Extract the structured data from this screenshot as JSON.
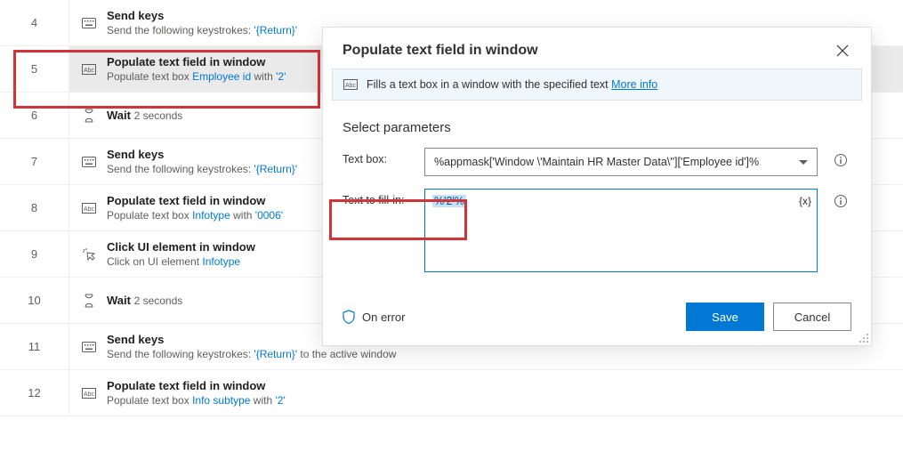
{
  "colors": {
    "accent": "#0078d4",
    "danger": "#d13438"
  },
  "steps": [
    {
      "num": "4",
      "icon": "keyboard",
      "title": "Send keys",
      "sub_prefix": "Send the following keystrokes: ",
      "sub_link": "",
      "sub_mid": "",
      "sub_lit": "'{Return}'",
      "sub_suffix": ""
    },
    {
      "num": "5",
      "icon": "abc-box",
      "title": "Populate text field in window",
      "sub_prefix": "Populate text box ",
      "sub_link": "Employee id",
      "sub_mid": " with ",
      "sub_lit": "'2'",
      "sub_suffix": "",
      "selected": true
    },
    {
      "num": "6",
      "icon": "hourglass",
      "title": "Wait",
      "sub_inline": "2 seconds"
    },
    {
      "num": "7",
      "icon": "keyboard",
      "title": "Send keys",
      "sub_prefix": "Send the following keystrokes: ",
      "sub_link": "",
      "sub_mid": "",
      "sub_lit": "'{Return}'",
      "sub_suffix": ""
    },
    {
      "num": "8",
      "icon": "abc-box",
      "title": "Populate text field in window",
      "sub_prefix": "Populate text box ",
      "sub_link": "Infotype",
      "sub_mid": " with ",
      "sub_lit": "'0006'",
      "sub_suffix": ""
    },
    {
      "num": "9",
      "icon": "click",
      "title": "Click UI element in window",
      "sub_prefix": "Click on UI element ",
      "sub_link": "Infotype",
      "sub_mid": "",
      "sub_lit": "",
      "sub_suffix": ""
    },
    {
      "num": "10",
      "icon": "hourglass",
      "title": "Wait",
      "sub_inline": "2 seconds"
    },
    {
      "num": "11",
      "icon": "keyboard",
      "title": "Send keys",
      "sub_prefix": "Send the following keystrokes: ",
      "sub_link": "",
      "sub_mid": "",
      "sub_lit": "'{Return}'",
      "sub_suffix": " to the active window"
    },
    {
      "num": "12",
      "icon": "abc-box",
      "title": "Populate text field in window",
      "sub_prefix": "Populate text box ",
      "sub_link": "Info subtype",
      "sub_mid": " with ",
      "sub_lit": "'2'",
      "sub_suffix": ""
    }
  ],
  "dialog": {
    "title": "Populate text field in window",
    "description": "Fills a text box in a window with the specified text ",
    "more_info": "More info",
    "section": "Select parameters",
    "params": {
      "textbox_label": "Text box:",
      "textbox_value": "%appmask['Window \\'Maintain HR Master Data\\'']['Employee id']%",
      "fillin_label": "Text to fill-in:",
      "fillin_value": "%'2'%",
      "fx_label": "{x}"
    },
    "on_error": "On error",
    "save": "Save",
    "cancel": "Cancel"
  }
}
